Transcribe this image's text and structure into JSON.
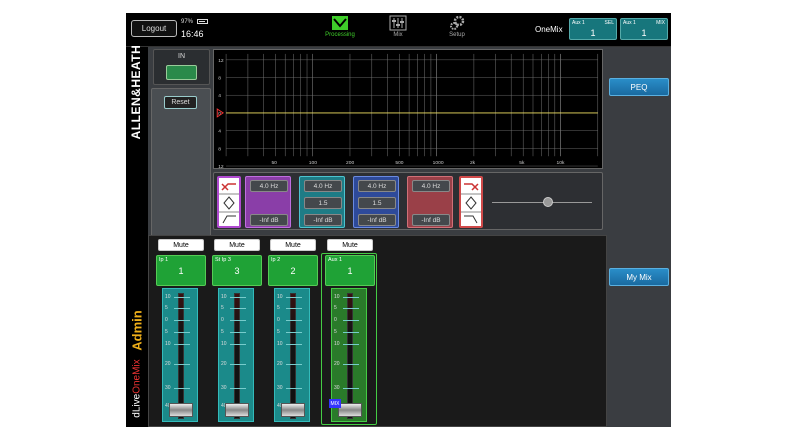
{
  "topbar": {
    "logout_label": "Logout",
    "battery": "97%",
    "time": "16:46",
    "tabs": [
      {
        "label": "Processing",
        "icon": "processing-icon",
        "active": true
      },
      {
        "label": "Mix",
        "icon": "mix-icon",
        "active": false
      },
      {
        "label": "Setup",
        "icon": "setup-icon",
        "active": false
      }
    ],
    "onemix_label": "OneMix",
    "aux_sel": {
      "name": "Aux 1",
      "tag": "SEL",
      "value": "1"
    },
    "aux_mix": {
      "name": "Aux 1",
      "tag": "MIX",
      "value": "1"
    }
  },
  "brand": {
    "name": "ALLEN&HEATH",
    "role": "Admin",
    "product": "dLive",
    "product_mode": "OneMix"
  },
  "right_panel": {
    "peq_label": "PEQ",
    "mymix_label": "My Mix"
  },
  "peq": {
    "in_label": "IN",
    "reset_label": "Reset",
    "graph": {
      "y_ticks": [
        "12",
        "8",
        "4",
        "0",
        "4",
        "8",
        "12"
      ],
      "x_ticks": [
        "50",
        "100",
        "200",
        "500",
        "1000",
        "2k",
        "5k",
        "10k"
      ]
    },
    "bands": [
      {
        "freq": "4.0 Hz",
        "q": "",
        "gain": "-Inf dB",
        "color": "#8a3ea8",
        "border": "#c06ee0"
      },
      {
        "freq": "4.0 Hz",
        "q": "1.5",
        "gain": "-Inf dB",
        "color": "#1e7c86",
        "border": "#4cc4d0"
      },
      {
        "freq": "4.0 Hz",
        "q": "1.5",
        "gain": "-Inf dB",
        "color": "#2e4a9a",
        "border": "#6a8ae0"
      },
      {
        "freq": "4.0 Hz",
        "q": "",
        "gain": "-Inf dB",
        "color": "#9a4048",
        "border": "#d07078"
      }
    ]
  },
  "mixer": {
    "strips": [
      {
        "mute": "Mute",
        "name": "Ip 1",
        "number": "1"
      },
      {
        "mute": "Mute",
        "name": "St Ip 3",
        "number": "3"
      },
      {
        "mute": "Mute",
        "name": "Ip 2",
        "number": "2"
      },
      {
        "mute": "Mute",
        "name": "Aux 1",
        "number": "1",
        "badge": "MIX"
      }
    ],
    "scale": [
      "10",
      "5",
      "0",
      "5",
      "10",
      "20",
      "30",
      "40"
    ]
  },
  "colors": {
    "accent_green": "#3fcf2a",
    "teal": "#17767c",
    "blue_button": "#2a8dc8"
  }
}
